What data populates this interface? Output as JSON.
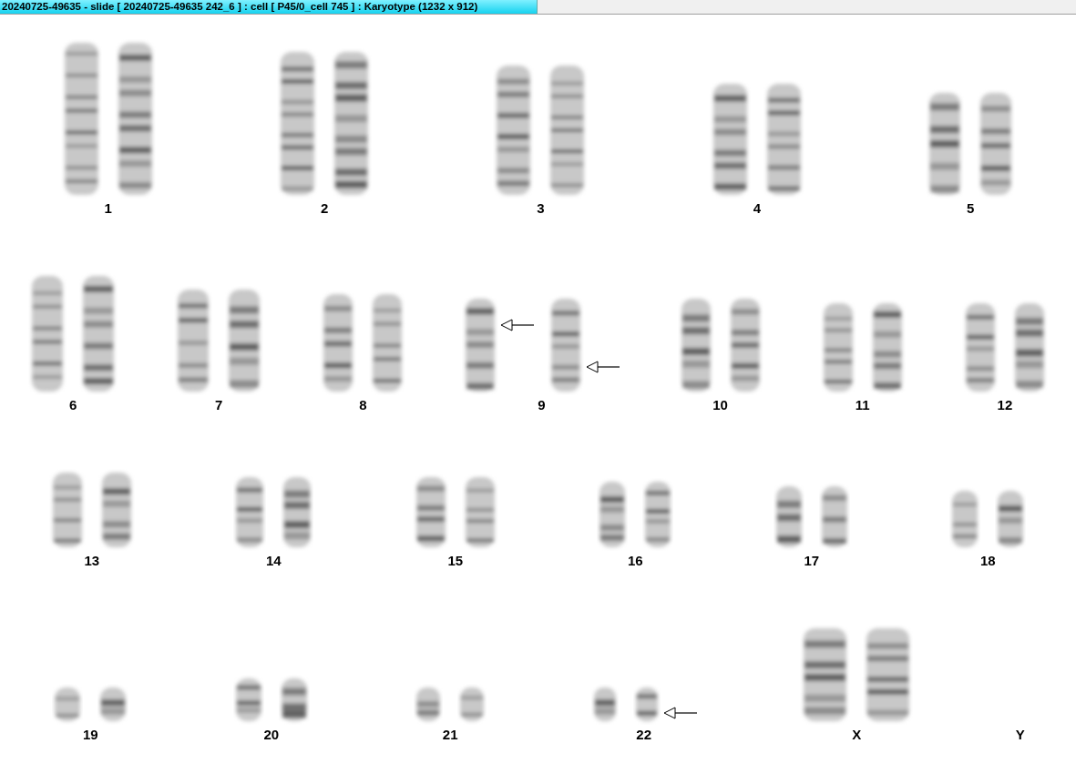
{
  "window": {
    "title": "20240725-49635 - slide [ 20240725-49635 242_6 ] : cell [ P45/0_cell 745 ] : Karyotype  (1232 x 912)"
  },
  "rows": [
    {
      "pairs": [
        {
          "label": "1",
          "homologs": [
            {
              "arrow": false
            },
            {
              "arrow": false
            }
          ]
        },
        {
          "label": "2",
          "homologs": [
            {
              "arrow": false
            },
            {
              "arrow": false
            }
          ]
        },
        {
          "label": "3",
          "homologs": [
            {
              "arrow": false
            },
            {
              "arrow": false
            }
          ]
        },
        {
          "label": "4",
          "homologs": [
            {
              "arrow": false
            },
            {
              "arrow": false
            }
          ]
        },
        {
          "label": "5",
          "homologs": [
            {
              "arrow": false
            },
            {
              "arrow": false
            }
          ]
        }
      ]
    },
    {
      "pairs": [
        {
          "label": "6",
          "homologs": [
            {
              "arrow": false
            },
            {
              "arrow": false
            }
          ]
        },
        {
          "label": "7",
          "homologs": [
            {
              "arrow": false
            },
            {
              "arrow": false
            }
          ]
        },
        {
          "label": "8",
          "homologs": [
            {
              "arrow": false
            },
            {
              "arrow": false
            }
          ]
        },
        {
          "label": "9",
          "homologs": [
            {
              "arrow": true
            },
            {
              "arrow": true
            }
          ]
        },
        {
          "label": "10",
          "homologs": [
            {
              "arrow": false
            },
            {
              "arrow": false
            }
          ]
        },
        {
          "label": "11",
          "homologs": [
            {
              "arrow": false
            },
            {
              "arrow": false
            }
          ]
        },
        {
          "label": "12",
          "homologs": [
            {
              "arrow": false
            },
            {
              "arrow": false
            }
          ]
        }
      ]
    },
    {
      "pairs": [
        {
          "label": "13",
          "homologs": [
            {
              "arrow": false
            },
            {
              "arrow": false
            }
          ]
        },
        {
          "label": "14",
          "homologs": [
            {
              "arrow": false
            },
            {
              "arrow": false
            }
          ]
        },
        {
          "label": "15",
          "homologs": [
            {
              "arrow": false
            },
            {
              "arrow": false
            }
          ]
        },
        {
          "label": "16",
          "homologs": [
            {
              "arrow": false
            },
            {
              "arrow": false
            }
          ]
        },
        {
          "label": "17",
          "homologs": [
            {
              "arrow": false
            },
            {
              "arrow": false
            }
          ]
        },
        {
          "label": "18",
          "homologs": [
            {
              "arrow": false
            },
            {
              "arrow": false
            }
          ]
        }
      ]
    },
    {
      "pairs": [
        {
          "label": "19",
          "homologs": [
            {
              "arrow": false
            },
            {
              "arrow": false
            }
          ]
        },
        {
          "label": "20",
          "homologs": [
            {
              "arrow": false
            },
            {
              "arrow": false
            }
          ]
        },
        {
          "label": "21",
          "homologs": [
            {
              "arrow": false
            },
            {
              "arrow": false
            }
          ]
        },
        {
          "label": "22",
          "homologs": [
            {
              "arrow": false
            },
            {
              "arrow": true
            }
          ]
        },
        {
          "label": "X",
          "homologs": [
            {
              "arrow": false
            },
            {
              "arrow": false
            }
          ]
        },
        {
          "label": "Y"
        }
      ]
    }
  ]
}
